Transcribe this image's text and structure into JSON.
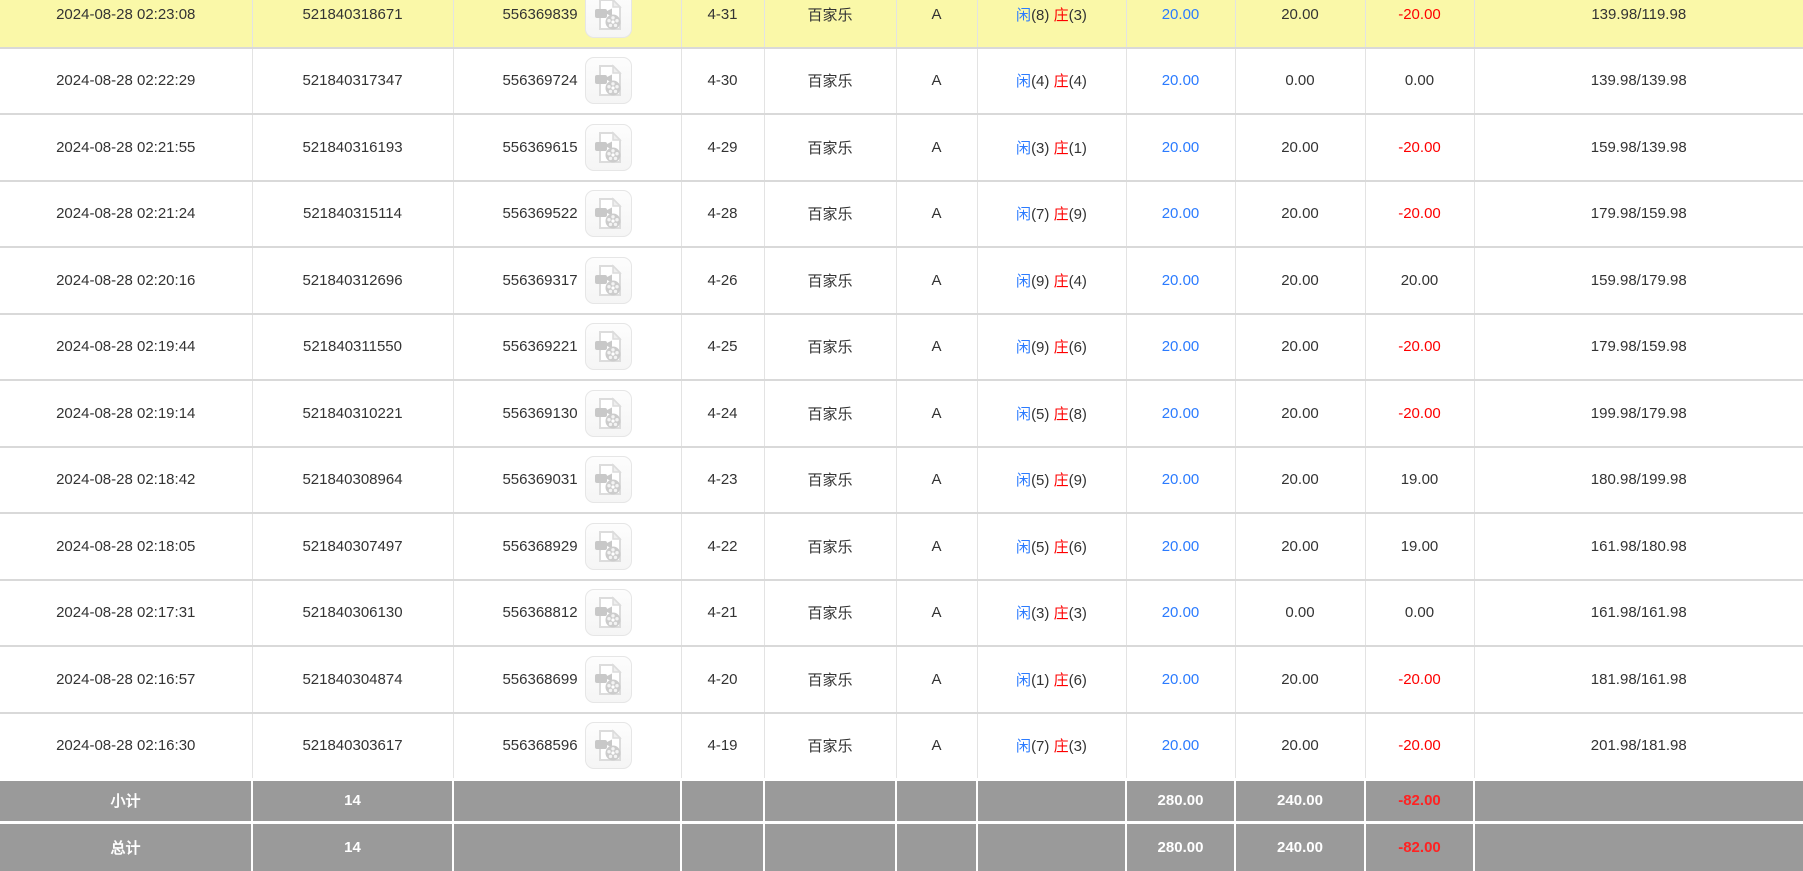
{
  "colors": {
    "accent_blue": "#2b7bff",
    "loss_red": "#fe0000",
    "highlight_yellow": "#faf8a8",
    "summary_gray": "#9a9a9a"
  },
  "rows": [
    {
      "time": "2024-08-28 02:23:08",
      "order_no": "521840318671",
      "round_no": "556369839",
      "table_round": "4-31",
      "game": "百家乐",
      "table_id": "A",
      "player_label": "闲",
      "player_points": "(8)",
      "banker_label": "庄",
      "banker_points": "(3)",
      "bet": "20.00",
      "valid": "20.00",
      "win_loss": "-20.00",
      "balance": "139.98/119.98",
      "highlighted": true
    },
    {
      "time": "2024-08-28 02:22:29",
      "order_no": "521840317347",
      "round_no": "556369724",
      "table_round": "4-30",
      "game": "百家乐",
      "table_id": "A",
      "player_label": "闲",
      "player_points": "(4)",
      "banker_label": "庄",
      "banker_points": "(4)",
      "bet": "20.00",
      "valid": "0.00",
      "win_loss": "0.00",
      "balance": "139.98/139.98",
      "highlighted": false
    },
    {
      "time": "2024-08-28 02:21:55",
      "order_no": "521840316193",
      "round_no": "556369615",
      "table_round": "4-29",
      "game": "百家乐",
      "table_id": "A",
      "player_label": "闲",
      "player_points": "(3)",
      "banker_label": "庄",
      "banker_points": "(1)",
      "bet": "20.00",
      "valid": "20.00",
      "win_loss": "-20.00",
      "balance": "159.98/139.98",
      "highlighted": false
    },
    {
      "time": "2024-08-28 02:21:24",
      "order_no": "521840315114",
      "round_no": "556369522",
      "table_round": "4-28",
      "game": "百家乐",
      "table_id": "A",
      "player_label": "闲",
      "player_points": "(7)",
      "banker_label": "庄",
      "banker_points": "(9)",
      "bet": "20.00",
      "valid": "20.00",
      "win_loss": "-20.00",
      "balance": "179.98/159.98",
      "highlighted": false
    },
    {
      "time": "2024-08-28 02:20:16",
      "order_no": "521840312696",
      "round_no": "556369317",
      "table_round": "4-26",
      "game": "百家乐",
      "table_id": "A",
      "player_label": "闲",
      "player_points": "(9)",
      "banker_label": "庄",
      "banker_points": "(4)",
      "bet": "20.00",
      "valid": "20.00",
      "win_loss": "20.00",
      "balance": "159.98/179.98",
      "highlighted": false
    },
    {
      "time": "2024-08-28 02:19:44",
      "order_no": "521840311550",
      "round_no": "556369221",
      "table_round": "4-25",
      "game": "百家乐",
      "table_id": "A",
      "player_label": "闲",
      "player_points": "(9)",
      "banker_label": "庄",
      "banker_points": "(6)",
      "bet": "20.00",
      "valid": "20.00",
      "win_loss": "-20.00",
      "balance": "179.98/159.98",
      "highlighted": false
    },
    {
      "time": "2024-08-28 02:19:14",
      "order_no": "521840310221",
      "round_no": "556369130",
      "table_round": "4-24",
      "game": "百家乐",
      "table_id": "A",
      "player_label": "闲",
      "player_points": "(5)",
      "banker_label": "庄",
      "banker_points": "(8)",
      "bet": "20.00",
      "valid": "20.00",
      "win_loss": "-20.00",
      "balance": "199.98/179.98",
      "highlighted": false
    },
    {
      "time": "2024-08-28 02:18:42",
      "order_no": "521840308964",
      "round_no": "556369031",
      "table_round": "4-23",
      "game": "百家乐",
      "table_id": "A",
      "player_label": "闲",
      "player_points": "(5)",
      "banker_label": "庄",
      "banker_points": "(9)",
      "bet": "20.00",
      "valid": "20.00",
      "win_loss": "19.00",
      "balance": "180.98/199.98",
      "highlighted": false
    },
    {
      "time": "2024-08-28 02:18:05",
      "order_no": "521840307497",
      "round_no": "556368929",
      "table_round": "4-22",
      "game": "百家乐",
      "table_id": "A",
      "player_label": "闲",
      "player_points": "(5)",
      "banker_label": "庄",
      "banker_points": "(6)",
      "bet": "20.00",
      "valid": "20.00",
      "win_loss": "19.00",
      "balance": "161.98/180.98",
      "highlighted": false
    },
    {
      "time": "2024-08-28 02:17:31",
      "order_no": "521840306130",
      "round_no": "556368812",
      "table_round": "4-21",
      "game": "百家乐",
      "table_id": "A",
      "player_label": "闲",
      "player_points": "(3)",
      "banker_label": "庄",
      "banker_points": "(3)",
      "bet": "20.00",
      "valid": "0.00",
      "win_loss": "0.00",
      "balance": "161.98/161.98",
      "highlighted": false
    },
    {
      "time": "2024-08-28 02:16:57",
      "order_no": "521840304874",
      "round_no": "556368699",
      "table_round": "4-20",
      "game": "百家乐",
      "table_id": "A",
      "player_label": "闲",
      "player_points": "(1)",
      "banker_label": "庄",
      "banker_points": "(6)",
      "bet": "20.00",
      "valid": "20.00",
      "win_loss": "-20.00",
      "balance": "181.98/161.98",
      "highlighted": false
    },
    {
      "time": "2024-08-28 02:16:30",
      "order_no": "521840303617",
      "round_no": "556368596",
      "table_round": "4-19",
      "game": "百家乐",
      "table_id": "A",
      "player_label": "闲",
      "player_points": "(7)",
      "banker_label": "庄",
      "banker_points": "(3)",
      "bet": "20.00",
      "valid": "20.00",
      "win_loss": "-20.00",
      "balance": "201.98/181.98",
      "highlighted": false
    }
  ],
  "summary": {
    "rows": [
      {
        "label": "小计",
        "count": "14",
        "bet": "280.00",
        "valid": "240.00",
        "win_loss": "-82.00"
      },
      {
        "label": "总计",
        "count": "14",
        "bet": "280.00",
        "valid": "240.00",
        "win_loss": "-82.00"
      }
    ]
  }
}
